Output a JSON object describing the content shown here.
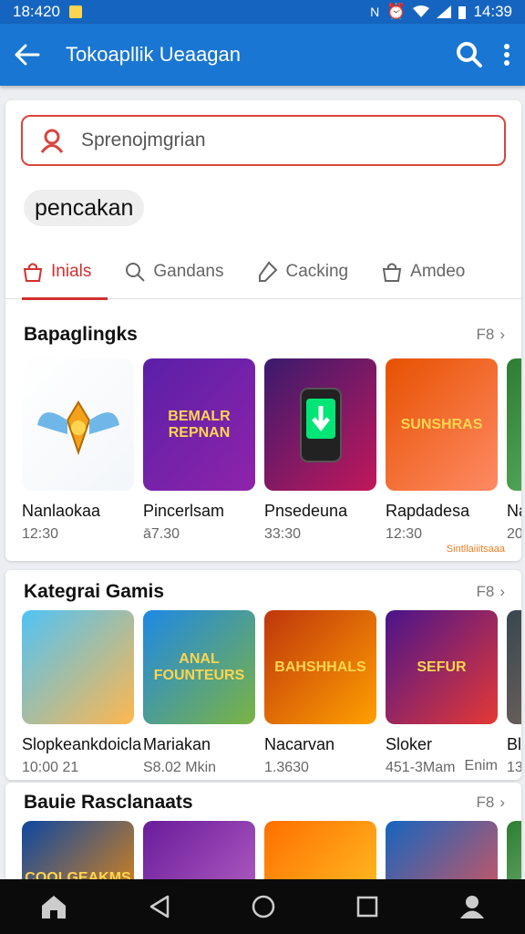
{
  "status": {
    "time_left": "18:420",
    "time_right": "14:39"
  },
  "appbar": {
    "title": "Tokoapllik Ueaagan"
  },
  "search": {
    "placeholder": "Sprenojmgrian"
  },
  "chip": "pencakan",
  "tabs": [
    {
      "label": "Inials",
      "icon": "bag-icon"
    },
    {
      "label": "Gandans",
      "icon": "search-icon"
    },
    {
      "label": "Cacking",
      "icon": "tag-icon"
    },
    {
      "label": "Amdeo",
      "icon": "bag-icon"
    }
  ],
  "sections": [
    {
      "title": "Bapaglingks",
      "more": "F8",
      "apps": [
        {
          "name": "Nanlaokaa",
          "sub": "12:30",
          "thumb_text": "",
          "colors": [
            "#ffffff",
            "#f3f6fa"
          ]
        },
        {
          "name": "Pincerlsam",
          "sub": "ā7.30",
          "thumb_text": "BEMALR REPNAN",
          "colors": [
            "#5b1fa8",
            "#8e24aa"
          ]
        },
        {
          "name": "Pnsedeuna",
          "sub": "33:30",
          "thumb_text": "",
          "colors": [
            "#3a1a6e",
            "#c2185b"
          ]
        },
        {
          "name": "Rapdadesa",
          "sub": "12:30",
          "thumb_text": "SUNSHRAS",
          "colors": [
            "#e65100",
            "#ff8a65"
          ]
        },
        {
          "name": "Na",
          "sub": "20",
          "thumb_text": "",
          "colors": [
            "#2e7d32",
            "#66bb6a"
          ]
        }
      ],
      "tagline": "Sintllaiiitsaaa"
    },
    {
      "title": "Kategrai Gamis",
      "more": "F8",
      "apps": [
        {
          "name": "Slopkeankdoicla",
          "sub": "10:00 21",
          "thumb_text": "",
          "colors": [
            "#4fc3f7",
            "#ffb74d"
          ]
        },
        {
          "name": "Mariakan",
          "sub": "S8.02 Mkin",
          "thumb_text": "ANAL FOUNTEURS",
          "colors": [
            "#1e88e5",
            "#7cb342"
          ]
        },
        {
          "name": "Nacarvan",
          "sub": "1.3630",
          "thumb_text": "BAHSHHALS",
          "colors": [
            "#bf360c",
            "#ffa000"
          ]
        },
        {
          "name": "Sloker",
          "sub": "451-3Mam",
          "sub2": "Enim",
          "thumb_text": "SEFUR",
          "colors": [
            "#4a148c",
            "#e53935"
          ]
        },
        {
          "name": "Ble",
          "sub": "13",
          "thumb_text": "",
          "colors": [
            "#37474f",
            "#8d6e63"
          ]
        }
      ]
    },
    {
      "title": "Bauie Rasclanaats",
      "more": "F8",
      "apps": [
        {
          "name": "",
          "sub": "",
          "thumb_text": "COOLGEAKMS",
          "colors": [
            "#0d47a1",
            "#ff8f00"
          ]
        },
        {
          "name": "",
          "sub": "",
          "thumb_text": "",
          "colors": [
            "#6a1b9a",
            "#ba68c8"
          ]
        },
        {
          "name": "",
          "sub": "",
          "thumb_text": "",
          "colors": [
            "#ff6f00",
            "#ffca28"
          ]
        },
        {
          "name": "",
          "sub": "",
          "thumb_text": "",
          "colors": [
            "#1565c0",
            "#ef5350"
          ]
        },
        {
          "name": "",
          "sub": "",
          "thumb_text": "",
          "colors": [
            "#2e7d32",
            "#a5d6a7"
          ]
        }
      ]
    }
  ]
}
